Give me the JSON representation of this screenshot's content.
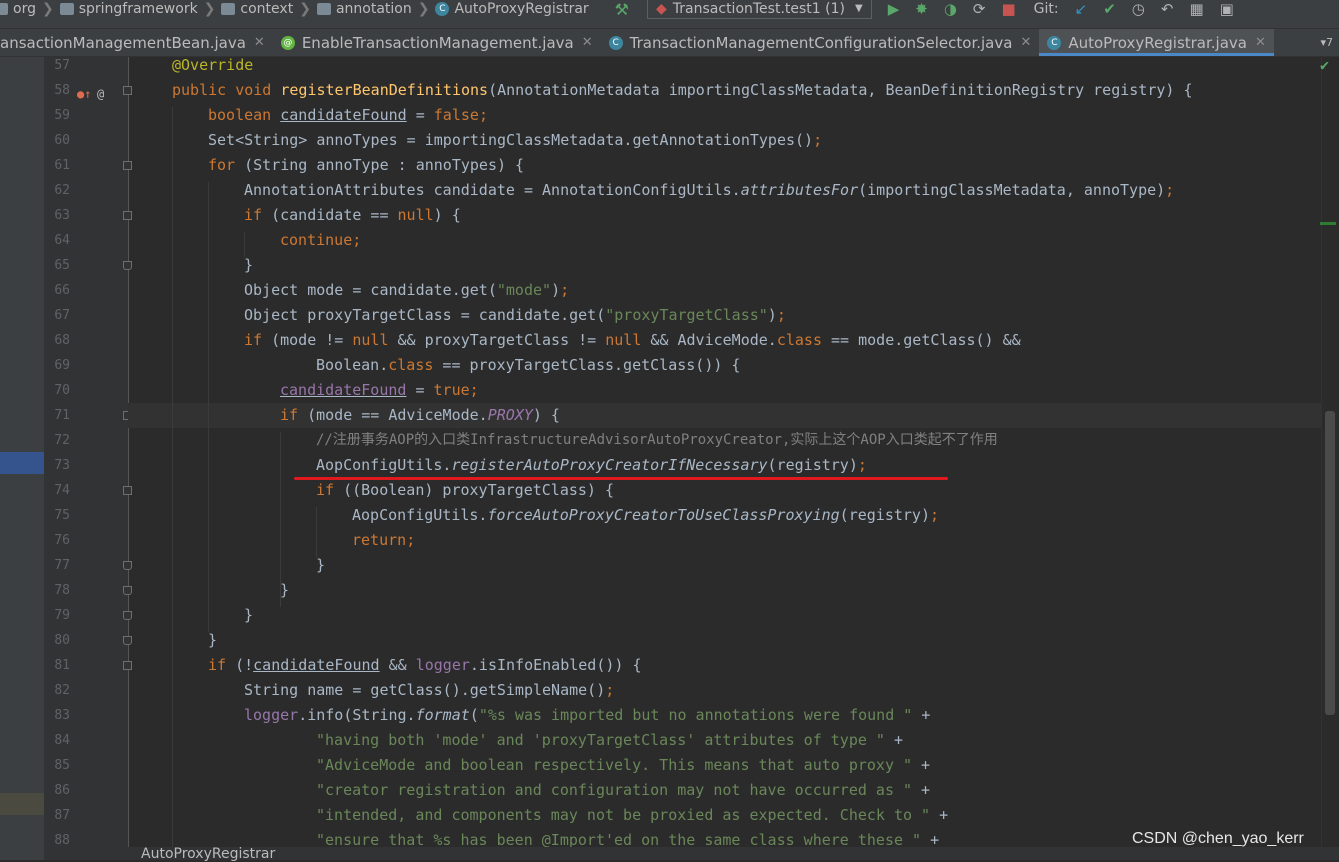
{
  "nav": {
    "crumbs": [
      "org",
      "springframework",
      "context",
      "annotation",
      "AutoProxyRegistrar"
    ],
    "run_config": "TransactionTest.test1 (1)",
    "git_label": "Git:"
  },
  "tabs": [
    {
      "label": "ansactionManagementBean.java",
      "icon": "class-icon",
      "active": false
    },
    {
      "label": "EnableTransactionManagement.java",
      "icon": "annotation-icon",
      "active": false
    },
    {
      "label": "TransactionManagementConfigurationSelector.java",
      "icon": "class-icon",
      "active": false
    },
    {
      "label": "AutoProxyRegistrar.java",
      "icon": "class-icon",
      "active": true
    }
  ],
  "tab_overflow": "▾7",
  "line_numbers": [
    "57",
    "58",
    "59",
    "60",
    "61",
    "62",
    "63",
    "64",
    "65",
    "66",
    "67",
    "68",
    "69",
    "70",
    "71",
    "72",
    "73",
    "74",
    "75",
    "76",
    "77",
    "78",
    "79",
    "80",
    "81",
    "82",
    "83",
    "84",
    "85",
    "86",
    "87",
    "88"
  ],
  "code": {
    "l57": {
      "a": "@Override"
    },
    "l58": {
      "a": "public void ",
      "b": "registerBeanDefinitions",
      "c": "(AnnotationMetadata importingClassMetadata, BeanDefinitionRegistry registry) {"
    },
    "l59": {
      "a": "boolean ",
      "b": "candidateFound",
      "c": " = ",
      "d": "false",
      ";": ";"
    },
    "l60": {
      "a": "Set<String> annoTypes = importingClassMetadata.getAnnotationTypes()",
      "b": ";"
    },
    "l61": {
      "a": "for ",
      "b": "(String annoType : annoTypes) {"
    },
    "l62": {
      "a": "AnnotationAttributes candidate = AnnotationConfigUtils.",
      "b": "attributesFor",
      "c": "(importingClassMetadata, annoType)",
      "d": ";"
    },
    "l63": {
      "a": "if ",
      "b": "(candidate == ",
      "c": "null",
      "d": ") {"
    },
    "l64": {
      "a": "continue",
      ";": ";"
    },
    "l65": {
      "a": "}"
    },
    "l66": {
      "a": "Object mode = candidate.get(",
      "b": "\"mode\"",
      "c": ")",
      "d": ";"
    },
    "l67": {
      "a": "Object proxyTargetClass = candidate.get(",
      "b": "\"proxyTargetClass\"",
      "c": ")",
      "d": ";"
    },
    "l68": {
      "a": "if ",
      "b": "(mode != ",
      "c": "null",
      "d": " && proxyTargetClass != ",
      "e": "null",
      "f": " && AdviceMode.",
      "g": "class",
      "h": " == mode.getClass() &&"
    },
    "l69": {
      "a": "Boolean.",
      "b": "class",
      "c": " == proxyTargetClass.getClass()) {"
    },
    "l70": {
      "a": "candidateFound",
      "b": " = ",
      "c": "true",
      ";": ";"
    },
    "l71": {
      "a": "if ",
      "b": "(mode == AdviceMode.",
      "c": "PROXY",
      "d": ") {"
    },
    "l72": {
      "a": "//注册事务AOP的入口类InfrastructureAdvisorAutoProxyCreator,实际上这个AOP入口类起不了作用"
    },
    "l73": {
      "a": "AopConfigUtils.",
      "b": "registerAutoProxyCreatorIfNecessary",
      "c": "(registry)",
      "d": ";"
    },
    "l74": {
      "a": "if ",
      "b": "((Boolean) proxyTargetClass) {"
    },
    "l75": {
      "a": "AopConfigUtils.",
      "b": "forceAutoProxyCreatorToUseClassProxying",
      "c": "(registry)",
      "d": ";"
    },
    "l76": {
      "a": "return",
      ";": ";"
    },
    "l77": {
      "a": "}"
    },
    "l78": {
      "a": "}"
    },
    "l79": {
      "a": "}"
    },
    "l80": {
      "a": "}"
    },
    "l81": {
      "a": "if ",
      "b": "(!",
      "c": "candidateFound",
      "d": " && ",
      "e": "logger",
      "f": ".isInfoEnabled()) {"
    },
    "l82": {
      "a": "String name = getClass().getSimpleName()",
      "b": ";"
    },
    "l83": {
      "a": "logger",
      "b": ".info(String.",
      "c": "format",
      "d": "(",
      "e": "\"%s was imported but no annotations were found \"",
      "f": " +"
    },
    "l84": {
      "a": "\"having both 'mode' and 'proxyTargetClass' attributes of type \"",
      "b": " +"
    },
    "l85": {
      "a": "\"AdviceMode and boolean respectively. This means that auto proxy \"",
      "b": " +"
    },
    "l86": {
      "a": "\"creator registration and configuration may not have occurred as \"",
      "b": " +"
    },
    "l87": {
      "a": "\"intended, and components may not be proxied as expected. Check to \"",
      "b": " +"
    },
    "l88": {
      "a": "\"ensure that %s has been @Import'ed on the same class where these \"",
      "b": " +"
    }
  },
  "bottom_breadcrumb": "AutoProxyRegistrar",
  "watermark": "CSDN @chen_yao_kerr",
  "colors": {
    "keyword": "#cc7832",
    "string": "#6a8759",
    "method_decl": "#ffc66d",
    "annotation": "#bbb529",
    "comment": "#808080",
    "field": "#9876aa",
    "highlight_underline": "#e0191f"
  }
}
